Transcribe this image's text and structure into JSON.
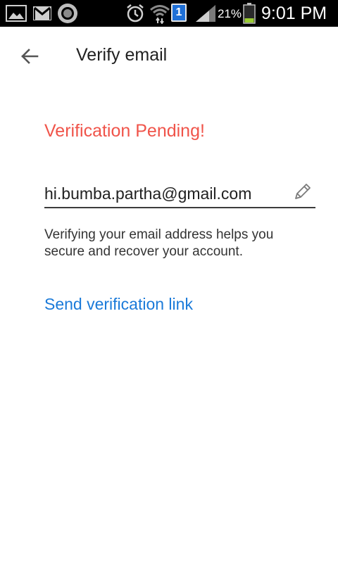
{
  "status_bar": {
    "battery_percent": "21%",
    "time": "9:01 PM",
    "notification_badge": "1",
    "icons": [
      "gallery-icon",
      "gmail-icon",
      "record-icon",
      "alarm-icon",
      "wifi-icon",
      "notification-badge-icon",
      "signal-icon",
      "battery-icon"
    ],
    "battery_level": 0.21,
    "battery_color": "#9acd32"
  },
  "app_bar": {
    "title": "Verify email",
    "back_icon": "arrow-back-icon"
  },
  "main": {
    "status_title": "Verification Pending!",
    "status_color": "#f0544a",
    "email": "hi.bumba.partha@gmail.com",
    "edit_icon": "pencil-icon",
    "description": "Verifying your email address helps you secure and recover your account.",
    "send_link_label": "Send verification link",
    "link_color": "#1a7ad9"
  }
}
